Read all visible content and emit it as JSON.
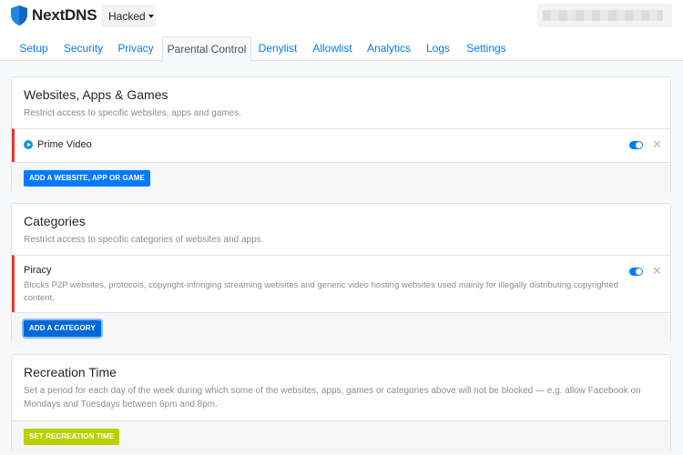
{
  "app": {
    "name": "NextDNS",
    "profile": "Hacked"
  },
  "colors": {
    "accent": "#007bff",
    "danger_border": "#e53935",
    "recreation_button": "#b9d000"
  },
  "tabs": [
    {
      "label": "Setup"
    },
    {
      "label": "Security"
    },
    {
      "label": "Privacy"
    },
    {
      "label": "Parental Control",
      "active": true
    },
    {
      "label": "Denylist"
    },
    {
      "label": "Allowlist"
    },
    {
      "label": "Analytics"
    },
    {
      "label": "Logs"
    },
    {
      "label": "Settings"
    }
  ],
  "websites": {
    "title": "Websites, Apps & Games",
    "description": "Restrict access to specific websites, apps and games.",
    "items": [
      {
        "icon": "prime-video-icon",
        "label": "Prime Video",
        "enabled": true
      }
    ],
    "add_button": "ADD A WEBSITE, APP OR GAME"
  },
  "categories": {
    "title": "Categories",
    "description": "Restrict access to specific categories of websites and apps.",
    "items": [
      {
        "label": "Piracy",
        "description": "Blocks P2P websites, protocols, copyright-infringing streaming websites and generic video hosting websites used mainly for illegally distributing copyrighted content.",
        "enabled": true
      }
    ],
    "add_button": "ADD A CATEGORY"
  },
  "recreation": {
    "title": "Recreation Time",
    "description": "Set a period for each day of the week during which some of the websites, apps, games or categories above will not be blocked — e.g. allow Facebook on Mondays and Tuesdays between 6pm and 8pm.",
    "button": "SET RECREATION TIME"
  }
}
